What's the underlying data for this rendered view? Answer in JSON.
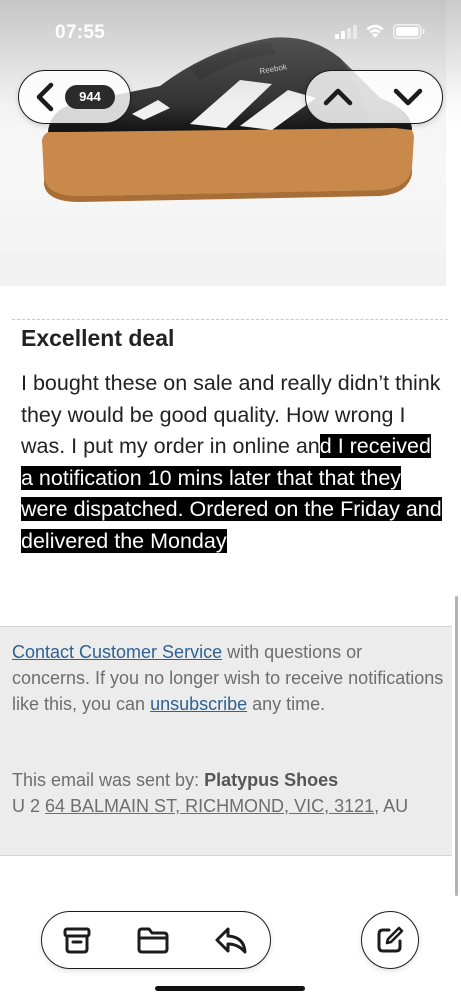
{
  "status_bar": {
    "time": "07:55"
  },
  "nav": {
    "unread_count": "944"
  },
  "review": {
    "title": "Excellent deal",
    "body_plain": "I bought these on sale and really didn’t think they would be good quality. How wrong I was. I put my order in online an",
    "body_highlighted": "d I received a notification 10 mins later that that they were dispatched. Ordered on the Friday and delivered the Monday"
  },
  "footer": {
    "contact_link": "Contact Customer Service",
    "contact_rest": " with questions or concerns. If you no longer wish to receive notifications like this, you can ",
    "unsubscribe_link": "unsubscribe",
    "unsubscribe_rest": " any time.",
    "sent_by_label": "This email was sent by: ",
    "sender": "Platypus Shoes",
    "address_prefix": "U 2 ",
    "address_underlined": "64 BALMAIN ST, RICHMOND, VIC, 3121",
    "address_suffix": ", AU"
  },
  "icons": {
    "back": "chevron-left-icon",
    "up": "chevron-up-icon",
    "down": "chevron-down-icon",
    "archive": "archive-icon",
    "folder": "folder-icon",
    "reply": "reply-icon",
    "compose": "compose-icon"
  },
  "colors": {
    "link": "#2f6192",
    "highlight_bg": "#000000",
    "footer_bg": "#ececec"
  }
}
